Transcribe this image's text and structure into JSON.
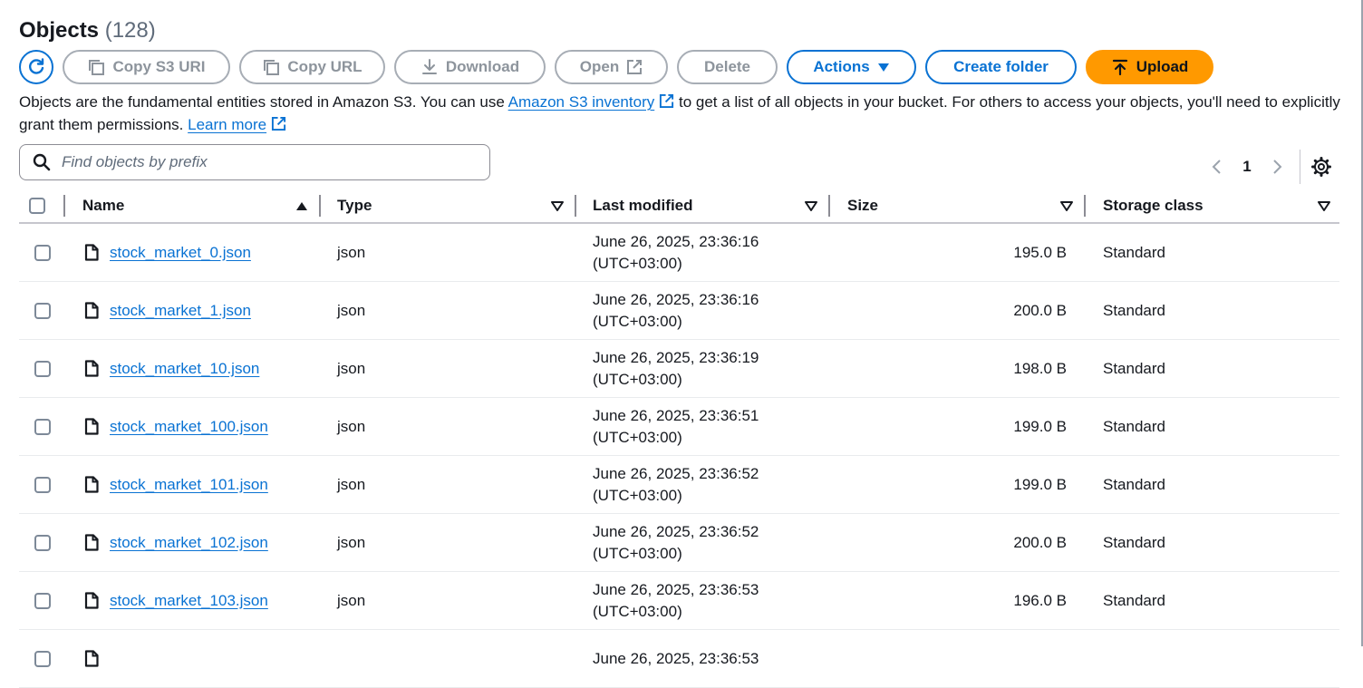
{
  "header": {
    "title": "Objects",
    "count": "(128)"
  },
  "toolbar": {
    "copy_s3_uri": "Copy S3 URI",
    "copy_url": "Copy URL",
    "download": "Download",
    "open": "Open",
    "delete": "Delete",
    "actions": "Actions",
    "create_folder": "Create folder",
    "upload": "Upload"
  },
  "description": {
    "part1": "Objects are the fundamental entities stored in Amazon S3. You can use",
    "inventory_link": "Amazon S3 inventory",
    "part2": "to get a list of all objects in your bucket. For others to access your objects, you'll need to explicitly grant them permissions.",
    "learn_more": "Learn more"
  },
  "search": {
    "placeholder": "Find objects by prefix",
    "value": ""
  },
  "pagination": {
    "current_page": "1"
  },
  "table": {
    "columns": [
      "Name",
      "Type",
      "Last modified",
      "Size",
      "Storage class"
    ],
    "rows": [
      {
        "name": "stock_market_0.json",
        "type": "json",
        "modified_date": "June 26, 2025, 23:36:16",
        "modified_tz": "(UTC+03:00)",
        "size": "195.0 B",
        "storage_class": "Standard"
      },
      {
        "name": "stock_market_1.json",
        "type": "json",
        "modified_date": "June 26, 2025, 23:36:16",
        "modified_tz": "(UTC+03:00)",
        "size": "200.0 B",
        "storage_class": "Standard"
      },
      {
        "name": "stock_market_10.json",
        "type": "json",
        "modified_date": "June 26, 2025, 23:36:19",
        "modified_tz": "(UTC+03:00)",
        "size": "198.0 B",
        "storage_class": "Standard"
      },
      {
        "name": "stock_market_100.json",
        "type": "json",
        "modified_date": "June 26, 2025, 23:36:51",
        "modified_tz": "(UTC+03:00)",
        "size": "199.0 B",
        "storage_class": "Standard"
      },
      {
        "name": "stock_market_101.json",
        "type": "json",
        "modified_date": "June 26, 2025, 23:36:52",
        "modified_tz": "(UTC+03:00)",
        "size": "199.0 B",
        "storage_class": "Standard"
      },
      {
        "name": "stock_market_102.json",
        "type": "json",
        "modified_date": "June 26, 2025, 23:36:52",
        "modified_tz": "(UTC+03:00)",
        "size": "200.0 B",
        "storage_class": "Standard"
      },
      {
        "name": "stock_market_103.json",
        "type": "json",
        "modified_date": "June 26, 2025, 23:36:53",
        "modified_tz": "(UTC+03:00)",
        "size": "196.0 B",
        "storage_class": "Standard"
      },
      {
        "name": "",
        "type": "",
        "modified_date": "June 26, 2025, 23:36:53",
        "modified_tz": "",
        "size": "",
        "storage_class": ""
      }
    ]
  },
  "colors": {
    "link": "#0972d3",
    "primary": "#ff9900",
    "disabled": "#8d949c"
  },
  "icons": [
    "refresh-icon",
    "copy-icon",
    "download-icon",
    "external-link-icon",
    "caret-down-icon",
    "upload-icon",
    "search-icon",
    "chevron-left-icon",
    "chevron-right-icon",
    "gear-icon",
    "sort-asc-icon",
    "sort-desc-icon",
    "file-icon"
  ]
}
